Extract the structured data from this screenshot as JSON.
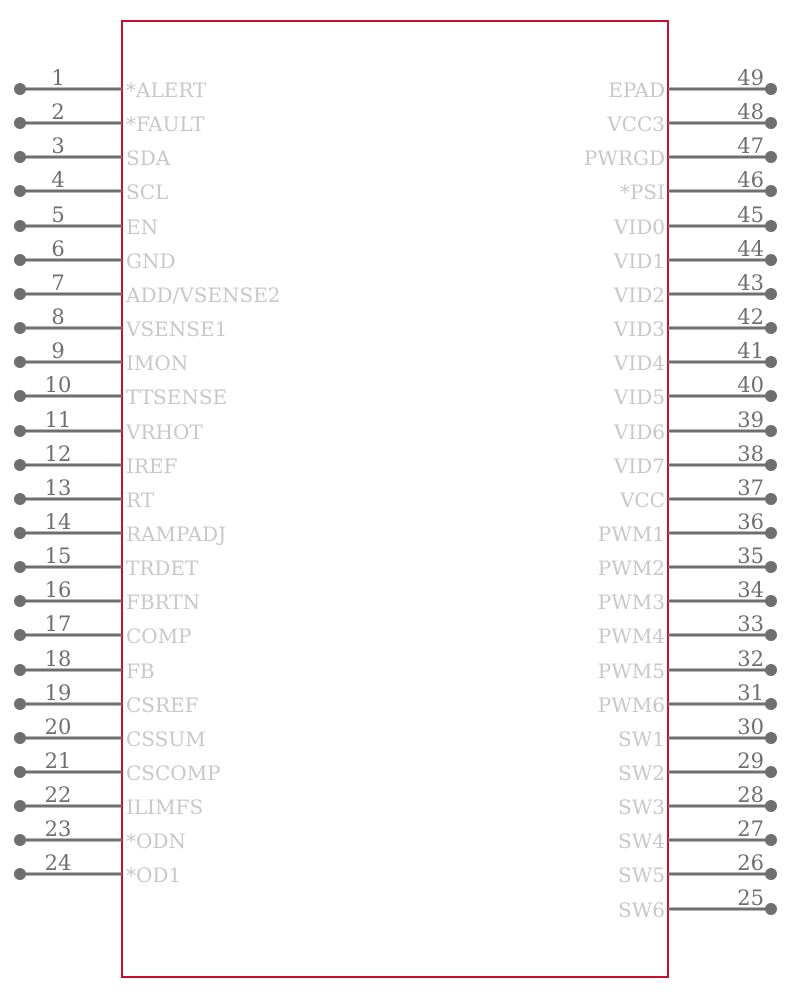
{
  "component": {
    "body_color": "#c8102e",
    "wire_color": "#6f6f6f",
    "label_color": "#c8c8c8",
    "number_color": "#6f6f6f"
  },
  "pins_left": [
    {
      "number": "1",
      "name": "*ALERT"
    },
    {
      "number": "2",
      "name": "*FAULT"
    },
    {
      "number": "3",
      "name": "SDA"
    },
    {
      "number": "4",
      "name": "SCL"
    },
    {
      "number": "5",
      "name": "EN"
    },
    {
      "number": "6",
      "name": "GND"
    },
    {
      "number": "7",
      "name": "ADD/VSENSE2"
    },
    {
      "number": "8",
      "name": "VSENSE1"
    },
    {
      "number": "9",
      "name": "IMON"
    },
    {
      "number": "10",
      "name": "TTSENSE"
    },
    {
      "number": "11",
      "name": "VRHOT"
    },
    {
      "number": "12",
      "name": "IREF"
    },
    {
      "number": "13",
      "name": "RT"
    },
    {
      "number": "14",
      "name": "RAMPADJ"
    },
    {
      "number": "15",
      "name": "TRDET"
    },
    {
      "number": "16",
      "name": "FBRTN"
    },
    {
      "number": "17",
      "name": "COMP"
    },
    {
      "number": "18",
      "name": "FB"
    },
    {
      "number": "19",
      "name": "CSREF"
    },
    {
      "number": "20",
      "name": "CSSUM"
    },
    {
      "number": "21",
      "name": "CSCOMP"
    },
    {
      "number": "22",
      "name": "ILIMFS"
    },
    {
      "number": "23",
      "name": "*ODN"
    },
    {
      "number": "24",
      "name": "*OD1"
    }
  ],
  "pins_right": [
    {
      "number": "49",
      "name": "EPAD"
    },
    {
      "number": "48",
      "name": "VCC3"
    },
    {
      "number": "47",
      "name": "PWRGD"
    },
    {
      "number": "46",
      "name": "*PSI"
    },
    {
      "number": "45",
      "name": "VID0"
    },
    {
      "number": "44",
      "name": "VID1"
    },
    {
      "number": "43",
      "name": "VID2"
    },
    {
      "number": "42",
      "name": "VID3"
    },
    {
      "number": "41",
      "name": "VID4"
    },
    {
      "number": "40",
      "name": "VID5"
    },
    {
      "number": "39",
      "name": "VID6"
    },
    {
      "number": "38",
      "name": "VID7"
    },
    {
      "number": "37",
      "name": "VCC"
    },
    {
      "number": "36",
      "name": "PWM1"
    },
    {
      "number": "35",
      "name": "PWM2"
    },
    {
      "number": "34",
      "name": "PWM3"
    },
    {
      "number": "33",
      "name": "PWM4"
    },
    {
      "number": "32",
      "name": "PWM5"
    },
    {
      "number": "31",
      "name": "PWM6"
    },
    {
      "number": "30",
      "name": "SW1"
    },
    {
      "number": "29",
      "name": "SW2"
    },
    {
      "number": "28",
      "name": "SW3"
    },
    {
      "number": "27",
      "name": "SW4"
    },
    {
      "number": "26",
      "name": "SW5"
    },
    {
      "number": "25",
      "name": "SW6"
    }
  ]
}
